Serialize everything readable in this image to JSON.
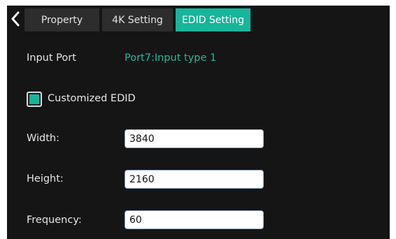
{
  "tabs": {
    "property": "Property",
    "k4_setting": "4K Setting",
    "edid_setting": "EDID Setting",
    "active": "EDID Setting"
  },
  "input_port": {
    "label": "Input Port",
    "value": "Port7:Input type 1"
  },
  "customized_edid": {
    "label": "Customized EDID",
    "checked": true
  },
  "width": {
    "label": "Width:",
    "value": "3840"
  },
  "height": {
    "label": "Height:",
    "value": "2160"
  },
  "frequency": {
    "label": "Frequency:",
    "value": "60"
  },
  "colors": {
    "accent": "#17b59a",
    "background": "#151515",
    "tab_inactive": "#2d2d2d"
  },
  "icons": {
    "back": "chevron-left-icon"
  }
}
